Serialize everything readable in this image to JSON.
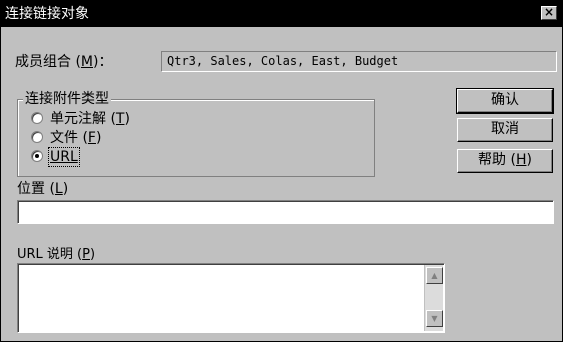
{
  "dialog": {
    "title": "连接链接对象",
    "close_glyph": "×"
  },
  "member_combo": {
    "label_main": "成员组合 (",
    "label_key": "M",
    "label_end": ")：",
    "value": "Qtr3, Sales, Colas, East, Budget"
  },
  "attach_type": {
    "legend": "连接附件类型",
    "options": [
      {
        "main": "单元注解 (",
        "key": "T",
        "end": ")",
        "checked": false
      },
      {
        "main": "文件 (",
        "key": "F",
        "end": ")",
        "checked": false
      },
      {
        "main": "",
        "key": "URL",
        "end": "",
        "checked": true
      }
    ]
  },
  "buttons": {
    "ok": "确认",
    "cancel": "取消",
    "help_main": "帮助 (",
    "help_key": "H",
    "help_end": ")"
  },
  "location": {
    "label_main": "位置 (",
    "label_key": "L",
    "label_end": ")",
    "value": ""
  },
  "url_desc": {
    "label_main": "URL 说明 (",
    "label_key": "P",
    "label_end": ")",
    "value": ""
  },
  "scrollbar": {
    "up_glyph": "▲",
    "down_glyph": "▼"
  }
}
